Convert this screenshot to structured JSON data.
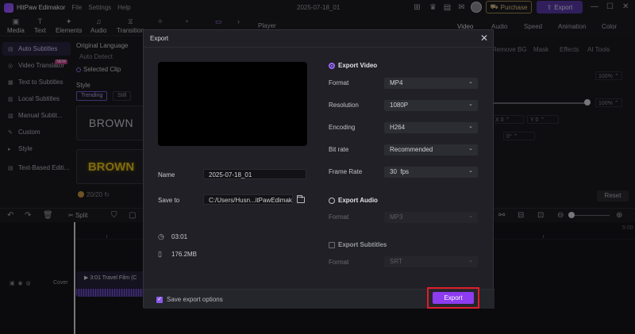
{
  "app": {
    "name": "HitPaw Edimakor",
    "menus": [
      "File",
      "Settings",
      "Help"
    ],
    "document_title": "2025-07-18_01",
    "purchase_label": "Purchase",
    "export_label": "Export"
  },
  "toolbar": {
    "items": [
      {
        "label": "Media",
        "icon": "media-icon"
      },
      {
        "label": "Text",
        "icon": "text-icon"
      },
      {
        "label": "Elements",
        "icon": "elements-icon"
      },
      {
        "label": "Audio",
        "icon": "audio-icon"
      },
      {
        "label": "Transition",
        "icon": "transition-icon"
      }
    ]
  },
  "sidenav": {
    "items": [
      {
        "label": "Auto Subtitles",
        "active": true
      },
      {
        "label": "Video Translator",
        "badge": "NEW"
      },
      {
        "label": "Text to Subtitles"
      },
      {
        "label": "Local Subtitles"
      },
      {
        "label": "Manual Subtit..."
      },
      {
        "label": "Custom"
      },
      {
        "label": "Style"
      },
      {
        "label": "Text-Based Editi..."
      }
    ]
  },
  "subpanel": {
    "original_language_label": "Original Language",
    "language_value": "Auto Detect",
    "selected_clip_label": "Selected Clip",
    "style_label": "Style",
    "style_tabs": [
      "Trending",
      "Still"
    ],
    "style_card_1_text": "BROWN",
    "style_card_2_text": "BROWN",
    "counter": "20/20"
  },
  "player": {
    "label": "Player"
  },
  "right_panel": {
    "tabs": [
      "Video",
      "Audio",
      "Speed",
      "Animation",
      "Color"
    ],
    "subtabs": [
      "Remove BG",
      "Mask",
      "Effects",
      "AI Tools"
    ],
    "percent_1": "100%",
    "percent_2": "100%",
    "x_label": "X",
    "x_value": "0",
    "y_label": "Y",
    "y_value": "0",
    "rotation_value": "0°",
    "reset_label": "Reset"
  },
  "timeline": {
    "split_label": "Split",
    "ruler_time": "5:00",
    "cover_label": "Cover",
    "clip_label": "3:01 Travel Film (C"
  },
  "export_dialog": {
    "title": "Export",
    "name_label": "Name",
    "name_value": "2025-07-18_01",
    "save_to_label": "Save to",
    "save_to_value": "C:/Users/Husn...itPawEdimakor",
    "duration": "03:01",
    "file_size": "176.2MB",
    "export_video_label": "Export Video",
    "format_label": "Format",
    "format_value": "MP4",
    "resolution_label": "Resolution",
    "resolution_value": "1080P",
    "encoding_label": "Encoding",
    "encoding_value": "H264",
    "bitrate_label": "Bit rate",
    "bitrate_value": "Recommended",
    "framerate_label": "Frame Rate",
    "framerate_value": "30  fps",
    "export_audio_label": "Export Audio",
    "audio_format_label": "Format",
    "audio_format_value": "MP3",
    "export_subtitles_label": "Export Subtitles",
    "subtitle_format_label": "Format",
    "subtitle_format_value": "SRT",
    "save_options_label": "Save export options",
    "export_button_label": "Export"
  },
  "colors": {
    "accent": "#8d3cf0",
    "highlight_box": "#e01d2a",
    "dialog_bg": "#202026"
  }
}
